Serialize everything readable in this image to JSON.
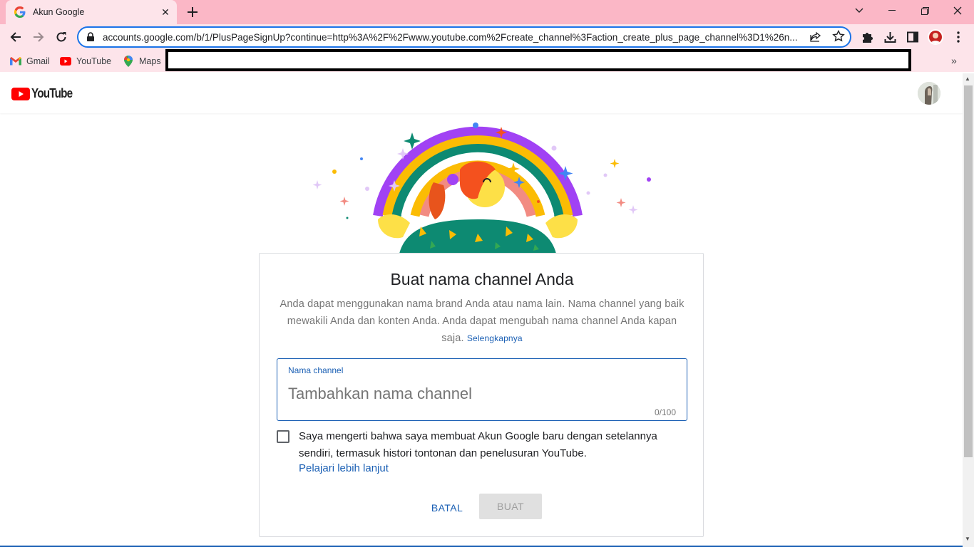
{
  "browser": {
    "tab_title": "Akun Google",
    "url": "accounts.google.com/b/1/PlusPageSignUp?continue=http%3A%2F%2Fwww.youtube.com%2Fcreate_channel%3Faction_create_plus_page_channel%3D1%26n...",
    "bookmarks": [
      {
        "label": "Gmail",
        "icon": "gmail-icon"
      },
      {
        "label": "YouTube",
        "icon": "youtube-icon"
      },
      {
        "label": "Maps",
        "icon": "maps-icon"
      }
    ],
    "bookmarks_more": "»"
  },
  "header": {
    "logo_text": "YouTube"
  },
  "card": {
    "title": "Buat nama channel Anda",
    "description": "Anda dapat menggunakan nama brand Anda atau nama lain. Nama channel yang baik mewakili Anda dan konten Anda. Anda dapat mengubah nama channel Anda kapan saja.",
    "learn_more": "Selengkapnya",
    "field_label": "Nama channel",
    "field_placeholder": "Tambahkan nama channel",
    "field_value": "",
    "char_count": "0/100",
    "checkbox_text": "Saya mengerti bahwa saya membuat Akun Google baru dengan setelannya sendiri, termasuk histori tontonan dan penelusuran YouTube.",
    "checkbox_checked": false,
    "checkbox_link": "Pelajari lebih lanjut",
    "cancel_label": "BATAL",
    "create_label": "BUAT"
  },
  "colors": {
    "tabstrip": "#fbb7c6",
    "toolbar": "#fde4ea",
    "accent_blue": "#1a5fb4",
    "youtube_red": "#ff0000"
  }
}
